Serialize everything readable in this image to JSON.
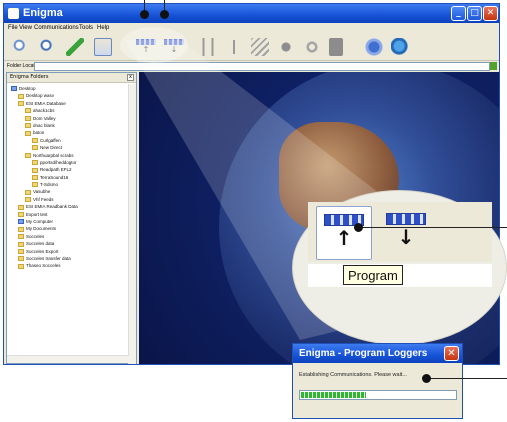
{
  "window": {
    "title": "Enigma",
    "controls": {
      "minimize": "_",
      "maximize": "□",
      "close": "✕"
    }
  },
  "menu": [
    "File",
    "View",
    "Communications",
    "Tools",
    "Help"
  ],
  "toolbar": {
    "left_icons": [
      "search-icon",
      "find-icon",
      "back-icon",
      "properties-icon"
    ],
    "logger_up": {
      "label": "▮▮▮▮",
      "arrow": "↑"
    },
    "logger_down": {
      "label": "▮▮▮▮",
      "arrow": "↓"
    },
    "right_icons": [
      "tool-1-icon",
      "tool-2-icon",
      "tool-3-icon",
      "tool-4-icon",
      "tool-5-icon",
      "tool-6-icon",
      "help-icon",
      "globe-icon"
    ]
  },
  "folder_location": {
    "label": "Folder Location:",
    "value": ""
  },
  "folder_pane": {
    "title": "Enigma Folders",
    "items": [
      {
        "label": "Desktop",
        "depth": 0,
        "icon": "blue"
      },
      {
        "label": "Desktop wasv",
        "depth": 1,
        "icon": "folder"
      },
      {
        "label": "ESI EMIA Database",
        "depth": 1,
        "icon": "folder"
      },
      {
        "label": "ahack1cbs",
        "depth": 2,
        "icon": "folder"
      },
      {
        "label": "Dom Valley",
        "depth": 2,
        "icon": "folder"
      },
      {
        "label": "dnac blank",
        "depth": 2,
        "icon": "folder"
      },
      {
        "label": "baton",
        "depth": 2,
        "icon": "folder"
      },
      {
        "label": "Curlgaffen",
        "depth": 3,
        "icon": "folder"
      },
      {
        "label": "New Direct",
        "depth": 3,
        "icon": "folder"
      },
      {
        "label": "Northuarpbal scrabs",
        "depth": 2,
        "icon": "folder"
      },
      {
        "label": "pportsd/heddogtor",
        "depth": 3,
        "icon": "folder"
      },
      {
        "label": "Readpath EFL2",
        "depth": 3,
        "icon": "folder"
      },
      {
        "label": "TerraSound16",
        "depth": 3,
        "icon": "folder"
      },
      {
        "label": "T-Sdsmo",
        "depth": 3,
        "icon": "folder"
      },
      {
        "label": "Vasubhe",
        "depth": 2,
        "icon": "folder"
      },
      {
        "label": "Vhf Feeds",
        "depth": 2,
        "icon": "folder"
      },
      {
        "label": "ESI EMIA Readbank Data",
        "depth": 1,
        "icon": "folder"
      },
      {
        "label": "Export test",
        "depth": 1,
        "icon": "folder"
      },
      {
        "label": "My Computer",
        "depth": 1,
        "icon": "blue"
      },
      {
        "label": "My Documents",
        "depth": 1,
        "icon": "folder"
      },
      {
        "label": "Socceles",
        "depth": 1,
        "icon": "folder"
      },
      {
        "label": "Socceles data",
        "depth": 1,
        "icon": "folder"
      },
      {
        "label": "Socceles Export",
        "depth": 1,
        "icon": "folder"
      },
      {
        "label": "Socceles transfer data",
        "depth": 1,
        "icon": "folder"
      },
      {
        "label": "Thaseo Socceles",
        "depth": 1,
        "icon": "folder"
      }
    ]
  },
  "callout": {
    "tooltip": "Program"
  },
  "dialog": {
    "title": "Enigma - Program Loggers",
    "message": "Establishing Communications. Please wait...",
    "progress": 0.42
  }
}
